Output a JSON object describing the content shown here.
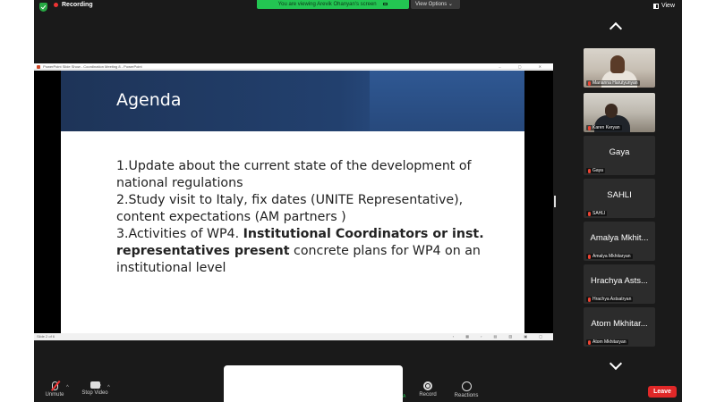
{
  "topbar": {
    "recording_label": "Recording",
    "share_banner": "You are viewing Arevik Ohanyan's screen",
    "view_options": "View Options ⌄",
    "view_label": "View"
  },
  "shared_screen": {
    "app_title": "PowerPoint Slide Show - Coordination Meeting 8 - PowerPoint",
    "window_controls": "– ▢ ✕",
    "slide": {
      "title": "Agenda",
      "items": [
        {
          "text": "1.Update about the current state of the development of national regulations"
        },
        {
          "text": "2.Study visit to Italy, fix dates (UNITE Representative), content expectations (AM partners )"
        },
        {
          "prefix": "3.Activities of WP4. ",
          "bold": "Institutional Coordinators or inst. representatives present",
          "suffix": " concrete plans for WP4  on an institutional level"
        }
      ]
    },
    "status_left": "Slide 2 of 6",
    "status_right": "‹ ▦ › ▤ ▥ ▣ ▢"
  },
  "participants": [
    {
      "tile_name": "",
      "label": "Marianna Harutyunyan",
      "video": "woman"
    },
    {
      "tile_name": "",
      "label": "Karen Keryan",
      "video": "man"
    },
    {
      "tile_name": "Gaya",
      "label": "Gaya"
    },
    {
      "tile_name": "SAHLI",
      "label": "SAHLI"
    },
    {
      "tile_name": "Amalya Mkhit...",
      "label": "Amalya Mkhitaryan"
    },
    {
      "tile_name": "Hrachya Asts...",
      "label": "Hrachya Astsatryan"
    },
    {
      "tile_name": "Atom Mkhitar...",
      "label": "Atom Mkhitaryan"
    }
  ],
  "toolbar": {
    "unmute": "Unmute",
    "stop_video": "Stop Video",
    "record": "Record",
    "reactions": "Reactions",
    "leave": "Leave",
    "caret": "^",
    "hint": "A"
  },
  "colors": {
    "banner_green": "#23c552",
    "leave_red": "#e02828",
    "slide_header": "#22406e"
  }
}
